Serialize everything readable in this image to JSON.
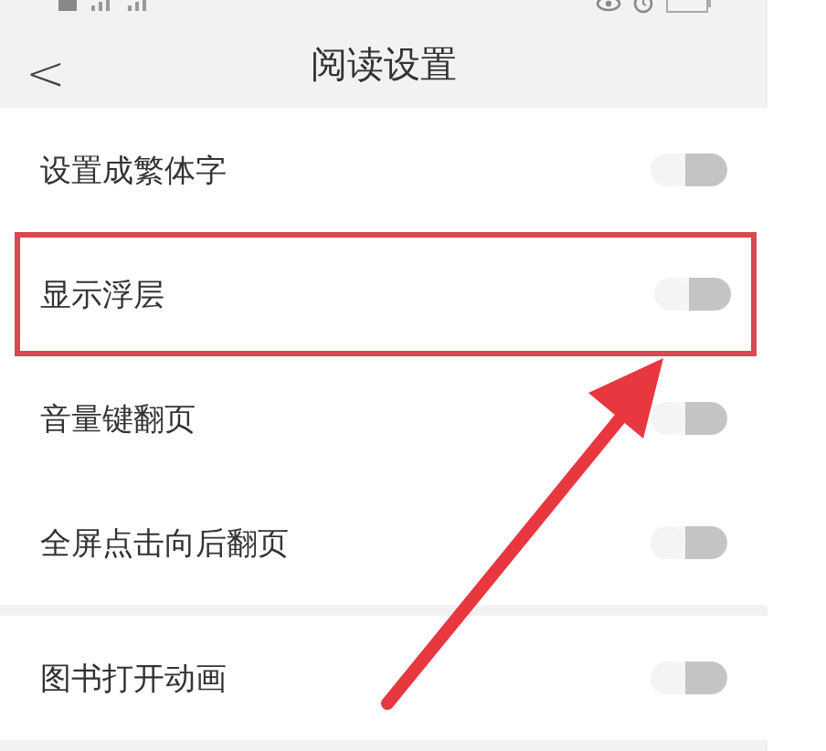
{
  "header": {
    "back": "<",
    "title": "阅读设置"
  },
  "groups": [
    {
      "rows": [
        {
          "label": "设置成繁体字",
          "on": false,
          "highlighted": false
        },
        {
          "label": "显示浮层",
          "on": false,
          "highlighted": true
        },
        {
          "label": "音量键翻页",
          "on": false,
          "highlighted": false
        },
        {
          "label": "全屏点击向后翻页",
          "on": false,
          "highlighted": false
        }
      ]
    },
    {
      "rows": [
        {
          "label": "图书打开动画",
          "on": false,
          "highlighted": false
        }
      ]
    }
  ]
}
